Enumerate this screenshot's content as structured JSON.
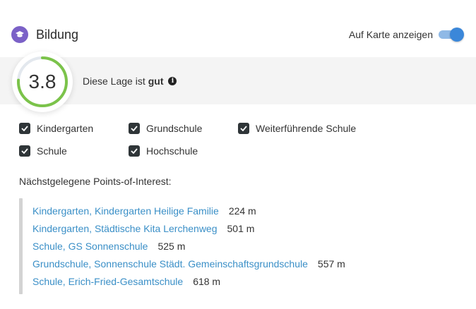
{
  "header": {
    "title": "Bildung",
    "icon": "graduation-cap-icon",
    "toggle_label": "Auf Karte anzeigen",
    "toggle_on": true
  },
  "score": {
    "value": "3.8",
    "max": 5,
    "text_prefix": "Diese Lage ist",
    "text_rating": "gut",
    "info_icon": "info-icon",
    "accent": "#7bc34a"
  },
  "filters": [
    {
      "label": "Kindergarten",
      "checked": true
    },
    {
      "label": "Grundschule",
      "checked": true
    },
    {
      "label": "Weiterführende Schule",
      "checked": true
    },
    {
      "label": "Schule",
      "checked": true
    },
    {
      "label": "Hochschule",
      "checked": true
    }
  ],
  "poi": {
    "heading": "Nächstgelegene Points-of-Interest:",
    "items": [
      {
        "name": "Kindergarten, Kindergarten Heilige Familie",
        "distance": "224 m"
      },
      {
        "name": "Kindergarten, Städtische Kita Lerchenweg",
        "distance": "501 m"
      },
      {
        "name": "Schule, GS Sonnenschule",
        "distance": "525 m"
      },
      {
        "name": "Grundschule, Sonnenschule Städt. Gemeinschaftsgrundschule",
        "distance": "557 m"
      },
      {
        "name": "Schule, Erich-Fried-Gesamtschule",
        "distance": "618 m"
      }
    ]
  },
  "colors": {
    "link": "#3a8fc7",
    "toggle": "#3b87d9",
    "category_icon": "#7b61c7"
  }
}
